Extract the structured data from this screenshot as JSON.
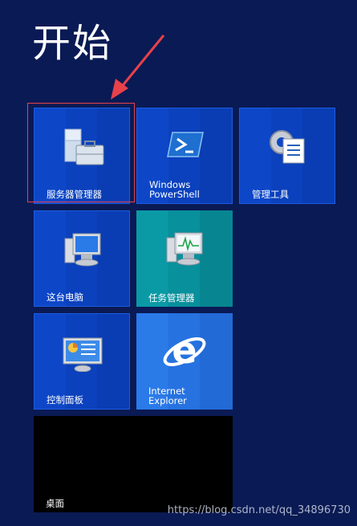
{
  "screen": {
    "title": "开始"
  },
  "tiles": {
    "server_manager": {
      "label": "服务器管理器"
    },
    "powershell": {
      "label": "Windows\nPowerShell"
    },
    "admin_tools": {
      "label": "管理工具"
    },
    "this_pc": {
      "label": "这台电脑"
    },
    "task_manager": {
      "label": "任务管理器"
    },
    "control_panel": {
      "label": "控制面板"
    },
    "ie": {
      "label": "Internet\nExplorer"
    },
    "desktop": {
      "label": "桌面"
    }
  },
  "watermark": {
    "text": "https://blog.csdn.net/qq_34896730"
  },
  "colors": {
    "background": "#0a1a54",
    "tile_blue": "#0d47c8",
    "tile_teal": "#0a9aa6",
    "tile_ie": "#2a7ae8",
    "tile_black": "#000000",
    "annotation_red": "#e8414a"
  },
  "icons": [
    "server-manager-icon",
    "powershell-icon",
    "admin-tools-icon",
    "computer-icon",
    "task-manager-icon",
    "control-panel-icon",
    "ie-logo-icon",
    "red-arrow-icon"
  ]
}
